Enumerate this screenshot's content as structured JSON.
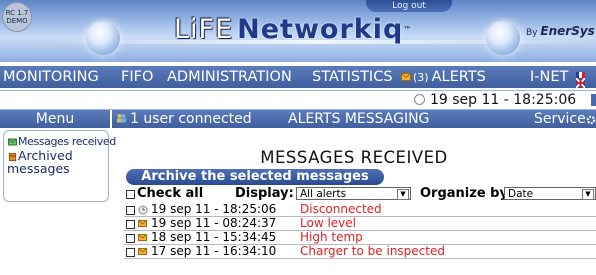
{
  "header": {
    "badge": "RC 1.7\nDEMO",
    "logout_label": "Log out",
    "logo_left": "LiFE",
    "logo_right": "Networkiq",
    "by_label": "By",
    "by_company": "EnerSys"
  },
  "nav": {
    "items": [
      "MONITORING",
      "FIFO",
      "ADMINISTRATION",
      "STATISTICS"
    ],
    "alerts_count": "(3)",
    "alerts_label": "ALERTS",
    "inet_label": "I-NET"
  },
  "datebar": {
    "datetime": "19 sep 11 - 18:25:06"
  },
  "menu": {
    "title": "Menu",
    "items": [
      "Messages received",
      "Archived",
      "messages"
    ]
  },
  "content": {
    "users_connected": "1 user connected",
    "section_title": "ALERTS MESSAGING",
    "service_label": "Service",
    "heading": "MESSAGES RECEIVED",
    "archive_button": "Archive the selected messages",
    "check_all": "Check all",
    "display_label": "Display:",
    "display_value": "All alerts",
    "organize_label": "Organize by:",
    "organize_value": "Date",
    "messages": [
      {
        "time": "19 sep 11 - 18:25:06",
        "text": "Disconnected",
        "icon": "clock-icon"
      },
      {
        "time": "19 sep 11 - 08:24:37",
        "text": "Low level",
        "icon": "envelope-icon"
      },
      {
        "time": "18 sep 11 - 15:34:45",
        "text": "High temp",
        "icon": "envelope-icon"
      },
      {
        "time": "17 sep 11 - 16:34:10",
        "text": "Charger to be inspected",
        "icon": "envelope-icon"
      }
    ]
  },
  "colors": {
    "nav_bg": "#4a6aab",
    "alert_text": "#e02020",
    "envelope": "#f1b236"
  }
}
